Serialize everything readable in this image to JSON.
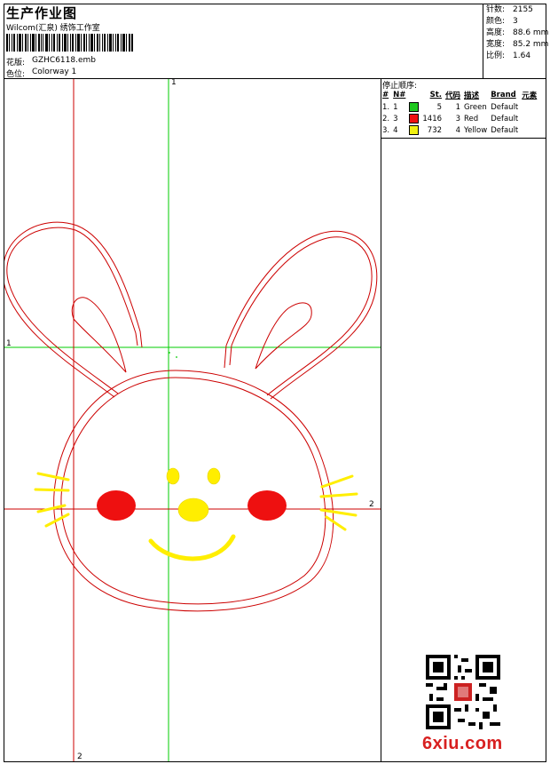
{
  "header": {
    "title": "生产作业图",
    "company": "Wilcom(汇泉) 绣饰工作室",
    "design_label": "花版:",
    "design_value": "GZHC6118.emb",
    "colorway_label": "色位:",
    "colorway_value": "Colorway 1"
  },
  "stats": [
    {
      "label": "针数:",
      "value": "2155"
    },
    {
      "label": "颜色:",
      "value": "3"
    },
    {
      "label": "高度:",
      "value": "88.6 mm"
    },
    {
      "label": "宽度:",
      "value": "85.2 mm"
    },
    {
      "label": "比例:",
      "value": "1.64"
    }
  ],
  "stop_sequence": {
    "title": "停止顺序:",
    "headers": [
      "#",
      "N#",
      "",
      "St.",
      "代码",
      "描述",
      "Brand",
      "元素"
    ],
    "rows": [
      {
        "index": "1.",
        "needle": "1",
        "color": "#1ec81e",
        "stitches": "5",
        "code": "1",
        "description": "Green",
        "brand": "Default",
        "elements": ""
      },
      {
        "index": "2.",
        "needle": "3",
        "color": "#ee1010",
        "stitches": "1416",
        "code": "3",
        "description": "Red",
        "brand": "Default",
        "elements": ""
      },
      {
        "index": "3.",
        "needle": "4",
        "color": "#f0f010",
        "stitches": "732",
        "code": "4",
        "description": "Yellow",
        "brand": "Default",
        "elements": ""
      }
    ]
  },
  "guides": {
    "green_marker_1": "1",
    "green_marker_2": "1",
    "red_marker_1": "2",
    "red_marker_2": "2"
  },
  "watermark": {
    "site": "6xiu.com"
  },
  "colors": {
    "red": "#cc0000",
    "green": "#00cc00",
    "yellow": "#ffee00",
    "fill_red": "#ee1010"
  },
  "icons": {
    "barcode": "barcode-icon",
    "qr": "qr-code-icon"
  }
}
